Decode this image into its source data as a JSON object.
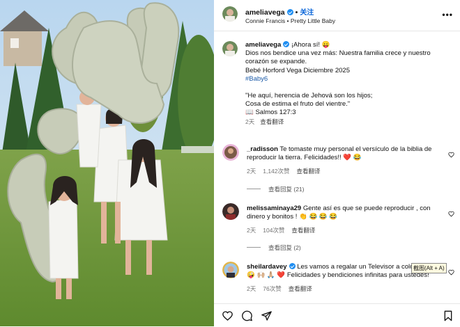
{
  "post": {
    "username": "ameliavega",
    "follow_label": "关注",
    "music": "Connie Francis • Pretty Little Baby"
  },
  "caption": {
    "username": "ameliavega",
    "line1": "¡Ahora sí! 😛",
    "line2": "Dios nos bendice una vez más: Nuestra familia crece y nuestro corazón se expande.",
    "line3": "Bebé Horford Vega Diciembre 2025",
    "hashtag": "#Baby6",
    "quote1": "\"He aquí, herencia de Jehová son los hijos;",
    "quote2": "Cosa de estima el fruto del vientre.\"",
    "verse": "📖 Salmos 127:3",
    "time": "2天",
    "translate": "查看翻译"
  },
  "comments": [
    {
      "username": "_radisson",
      "text": "Te tomaste muy personal el versículo de la biblia de reproducir la tierra. Felicidades!! ❤️ 😂",
      "time": "2天",
      "likes": "1,142次赞",
      "translate": "查看翻译",
      "replies": "查看回复 (21)"
    },
    {
      "username": "melissaminaya29",
      "text": "Gente así es que se puede reproducir , con dinero y bonitos ! 👏 😂 😂 😂",
      "time": "2天",
      "likes": "104次赞",
      "translate": "查看翻译",
      "replies": "查看回复 (2)"
    },
    {
      "username": "sheilardavey",
      "text_a": "Les vamos a regalar un Televisor a colo",
      "text_b": "🤪 🙌🏼 🙏🏼 ❤️ Felicidades y bendiciones infinitas para ustedes!",
      "time": "2天",
      "likes": "76次赞",
      "translate": "查看翻译"
    }
  ],
  "tooltip": "截图(Alt + A)",
  "icons": [
    "heart-icon",
    "comment-icon",
    "share-icon",
    "bookmark-icon",
    "more-icon",
    "verified-icon"
  ],
  "colors": {
    "link": "#1c5ba8",
    "verified": "#1f8ef1",
    "follow": "#0a66d9",
    "muted": "#737373"
  }
}
